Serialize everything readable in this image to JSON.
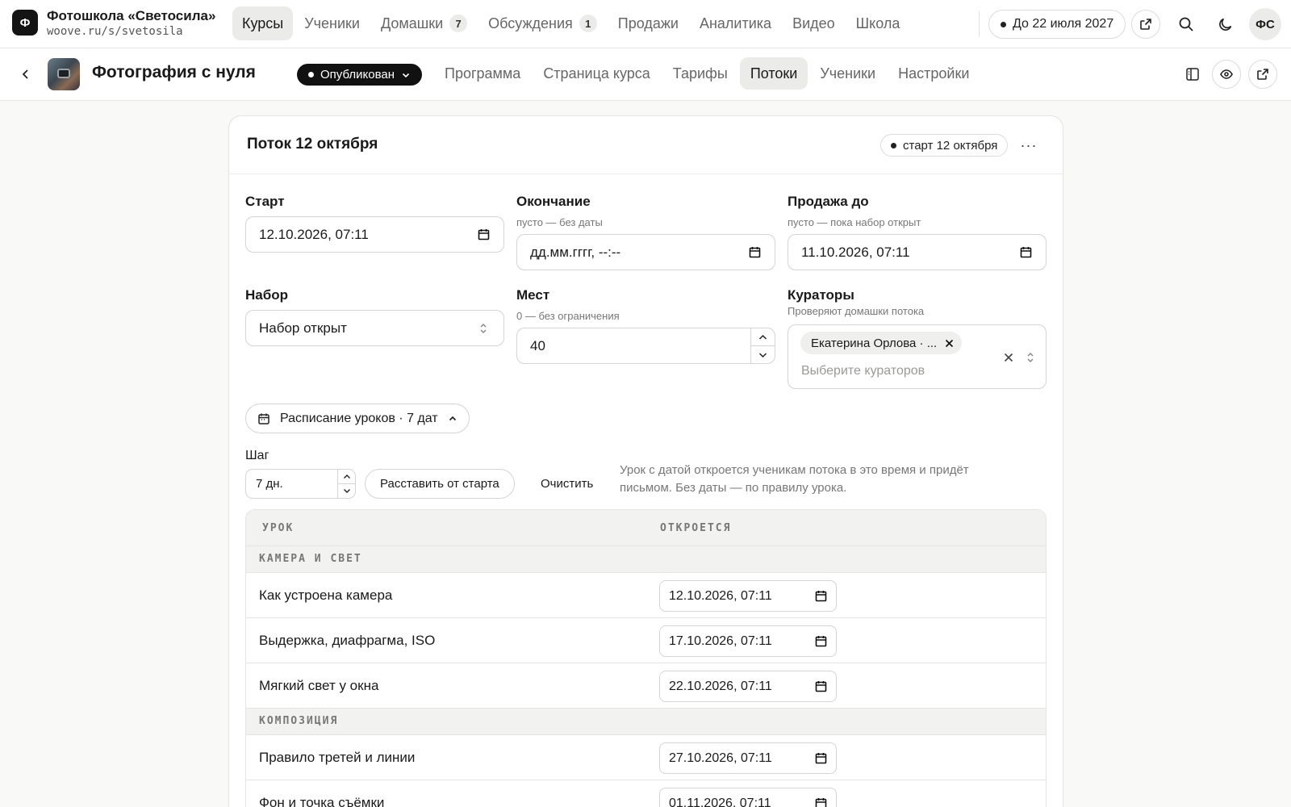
{
  "topbar": {
    "logo_letter": "Ф",
    "school_name": "Фотошкола «Светосила»",
    "school_url": "woove.ru/s/svetosila",
    "nav": [
      {
        "label": "Курсы",
        "active": true
      },
      {
        "label": "Ученики"
      },
      {
        "label": "Домашки",
        "badge": "7"
      },
      {
        "label": "Обсуждения",
        "badge": "1"
      },
      {
        "label": "Продажи"
      },
      {
        "label": "Аналитика"
      },
      {
        "label": "Видео"
      },
      {
        "label": "Школа"
      }
    ],
    "plan_label": "До 22 июля 2027",
    "avatar_initials": "ФС"
  },
  "coursebar": {
    "title": "Фотография с нуля",
    "status": "Опубликован",
    "tabs": [
      "Программа",
      "Страница курса",
      "Тарифы",
      "Потоки",
      "Ученики",
      "Настройки"
    ],
    "active_tab": "Потоки"
  },
  "stream": {
    "title": "Поток 12 октября",
    "start_badge": "старт 12 октября",
    "fields": {
      "start": {
        "label": "Старт",
        "value": "12.10.2026, 07:11"
      },
      "end": {
        "label": "Окончание",
        "hint": "пусто — без даты",
        "value": "дд.мм.гггг, --:--"
      },
      "sale_until": {
        "label": "Продажа до",
        "hint": "пусто — пока набор открыт",
        "value": "11.10.2026, 07:11"
      },
      "enrollment": {
        "label": "Набор",
        "value": "Набор открыт"
      },
      "seats": {
        "label": "Мест",
        "hint": "0 — без ограничения",
        "value": "40"
      },
      "curators": {
        "label": "Кураторы",
        "hint": "Проверяют домашки потока",
        "chip": "Екатерина Орлова · ...",
        "placeholder": "Выберите кураторов"
      }
    },
    "schedule": {
      "toggle_label": "Расписание уроков · 7 дат",
      "step_label": "Шаг",
      "step_value": "7 дн.",
      "arrange_button": "Расставить от старта",
      "clear_button": "Очистить",
      "help_text": "Урок с датой откроется ученикам потока в это время и придёт письмом. Без даты — по правилу урока.",
      "col_lesson": "УРОК",
      "col_opens": "ОТКРОЕТСЯ",
      "groups": [
        {
          "name": "КАМЕРА И СВЕТ",
          "lessons": [
            {
              "title": "Как устроена камера",
              "date": "12.10.2026, 07:11"
            },
            {
              "title": "Выдержка, диафрагма, ISO",
              "date": "17.10.2026, 07:11"
            },
            {
              "title": "Мягкий свет у окна",
              "date": "22.10.2026, 07:11"
            }
          ]
        },
        {
          "name": "КОМПОЗИЦИЯ",
          "lessons": [
            {
              "title": "Правило третей и линии",
              "date": "27.10.2026, 07:11"
            },
            {
              "title": "Фон и точка съёмки",
              "date": "01.11.2026, 07:11"
            }
          ]
        }
      ]
    }
  }
}
